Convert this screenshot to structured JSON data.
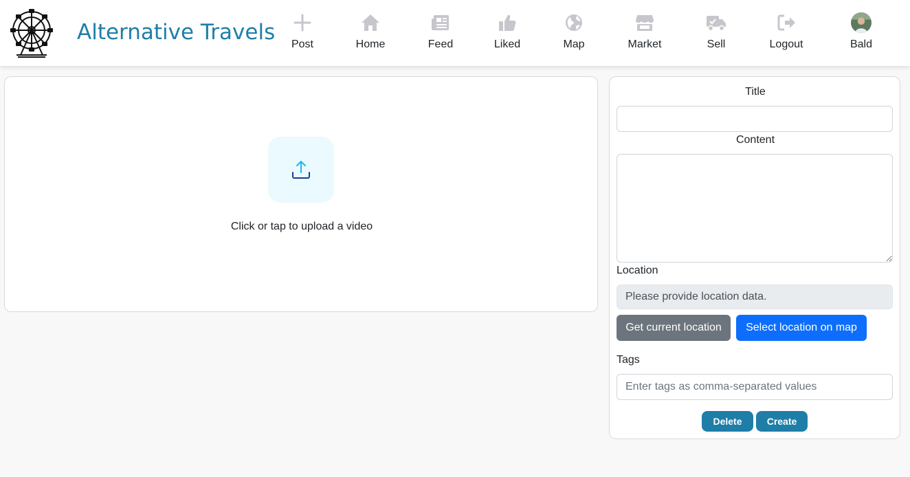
{
  "header": {
    "brand": "Alternative Travels",
    "nav": [
      {
        "label": "Post",
        "icon": "plus-icon"
      },
      {
        "label": "Home",
        "icon": "home-icon"
      },
      {
        "label": "Feed",
        "icon": "newspaper-icon"
      },
      {
        "label": "Liked",
        "icon": "thumbs-up-icon"
      },
      {
        "label": "Map",
        "icon": "globe-icon"
      },
      {
        "label": "Market",
        "icon": "store-icon"
      },
      {
        "label": "Sell",
        "icon": "truck-icon"
      },
      {
        "label": "Logout",
        "icon": "logout-icon"
      },
      {
        "label": "Bald",
        "icon": "avatar"
      }
    ]
  },
  "upload": {
    "text": "Click or tap to upload a video"
  },
  "form": {
    "title_label": "Title",
    "title_value": "",
    "content_label": "Content",
    "content_value": "",
    "location_label": "Location",
    "location_value": "Please provide location data.",
    "get_location_label": "Get current location",
    "select_map_label": "Select location on map",
    "tags_label": "Tags",
    "tags_placeholder": "Enter tags as comma-separated values",
    "delete_label": "Delete",
    "create_label": "Create"
  },
  "colors": {
    "brand": "#1f7ea8",
    "nav_icon": "#c6c6cc",
    "primary": "#0d6efd",
    "secondary": "#6c757d"
  }
}
